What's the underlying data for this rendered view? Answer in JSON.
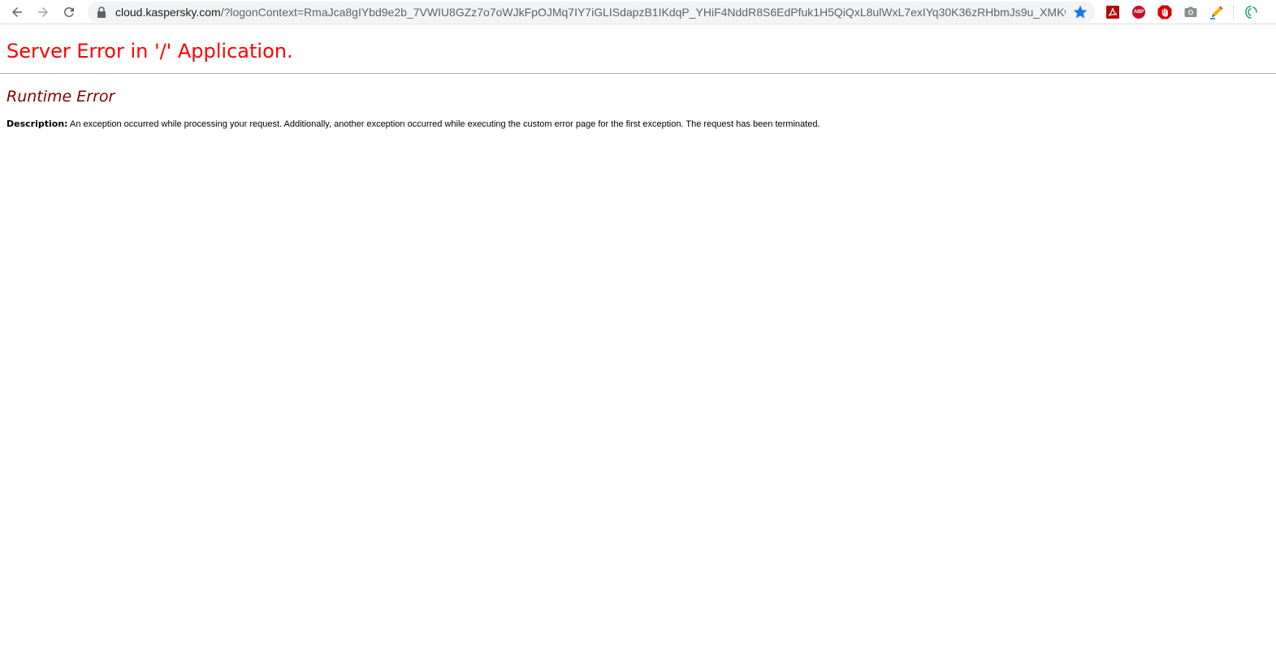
{
  "browser": {
    "url_host": "cloud.kaspersky.com",
    "url_rest": "/?logonContext=RmaJca8gIYbd9e2b_7VWIU8GZz7o7oWJkFpOJMq7IY7iGLISdapzB1IKdqP_YHiF4NddR8S6EdPfuk1H5QiQxL8ulWxL7exIYq30K36zRHbmJs9u_XMKwXPAE...",
    "extensions": [
      "pdf-icon",
      "adblock-plus-icon",
      "stop-icon",
      "camera-icon",
      "pencil-icon",
      "spiral-icon"
    ],
    "abp_label": "ABP"
  },
  "page": {
    "title": "Server Error in '/' Application.",
    "subtitle": "Runtime Error",
    "description_label": "Description:",
    "description_text": "An exception occurred while processing your request. Additionally, another exception occurred while executing the custom error page for the first exception. The request has been terminated."
  },
  "colors": {
    "title": "#ff0000",
    "subtitle": "#800000",
    "omnibox_bg": "#f1f3f4",
    "star": "#1a73e8"
  }
}
